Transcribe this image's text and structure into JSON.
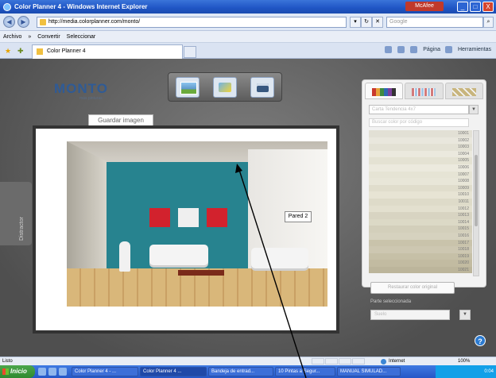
{
  "window": {
    "title": "Color Planner 4 - Windows Internet Explorer",
    "mcafee": "McAfee",
    "minimize": "_",
    "maximize": "□",
    "close": "X"
  },
  "addressbar": {
    "url": "http://media.colorplanner.com/monto/",
    "search_placeholder": "Google"
  },
  "linksbar": {
    "items": [
      "Archivo",
      "»",
      "Convertir",
      "Seleccionar"
    ]
  },
  "tabbar": {
    "tab_title": "Color Planner 4",
    "commands": [
      "Página",
      "Herramientas"
    ]
  },
  "app": {
    "brand": "MONTO",
    "brand_tagline": "más pinturas",
    "save_tab": "Guardar imagen",
    "wall_callout": "Pared 2",
    "distractor": "Distractor",
    "palette": {
      "collection": "Carta Tendencia 4x7",
      "search_placeholder": "Buscar color por código",
      "codes": [
        "10001",
        "10002",
        "10003",
        "10004",
        "10005",
        "10006",
        "10007",
        "10008",
        "10009",
        "10010",
        "10011",
        "10012",
        "10013",
        "10014",
        "10015",
        "10016",
        "10017",
        "10018",
        "10019",
        "10020",
        "10021"
      ],
      "swatches": [
        "#e2e0d5",
        "#e9e7dd",
        "#e3e1d4",
        "#ebe9de",
        "#e4e2d3",
        "#eceade",
        "#e6e4d5",
        "#e8e6d8",
        "#e0ddcc",
        "#e7e4d4",
        "#dedbc9",
        "#e3e0cf",
        "#d8d4c2",
        "#dcd9c6",
        "#d3cfbb",
        "#d6d2bf",
        "#c9c3ab",
        "#cdc7b1",
        "#c6c0a7",
        "#c2bba1",
        "#bcb59b"
      ],
      "restore": "Restaurar color original",
      "part_label": "Parte seleccionada",
      "part_value": "Suelo"
    },
    "help": "?"
  },
  "statusbar": {
    "left": "Listo",
    "zone": "Internet",
    "zoom": "100%"
  },
  "taskbar": {
    "start": "Inicio",
    "tasks": [
      "Color Planner 4 - ...",
      "Color Planner 4 ...",
      "Bandeja de entrad...",
      "10 Pintas a Segur...",
      "MANUAL SIMULAD..."
    ],
    "clock": "0:04"
  }
}
